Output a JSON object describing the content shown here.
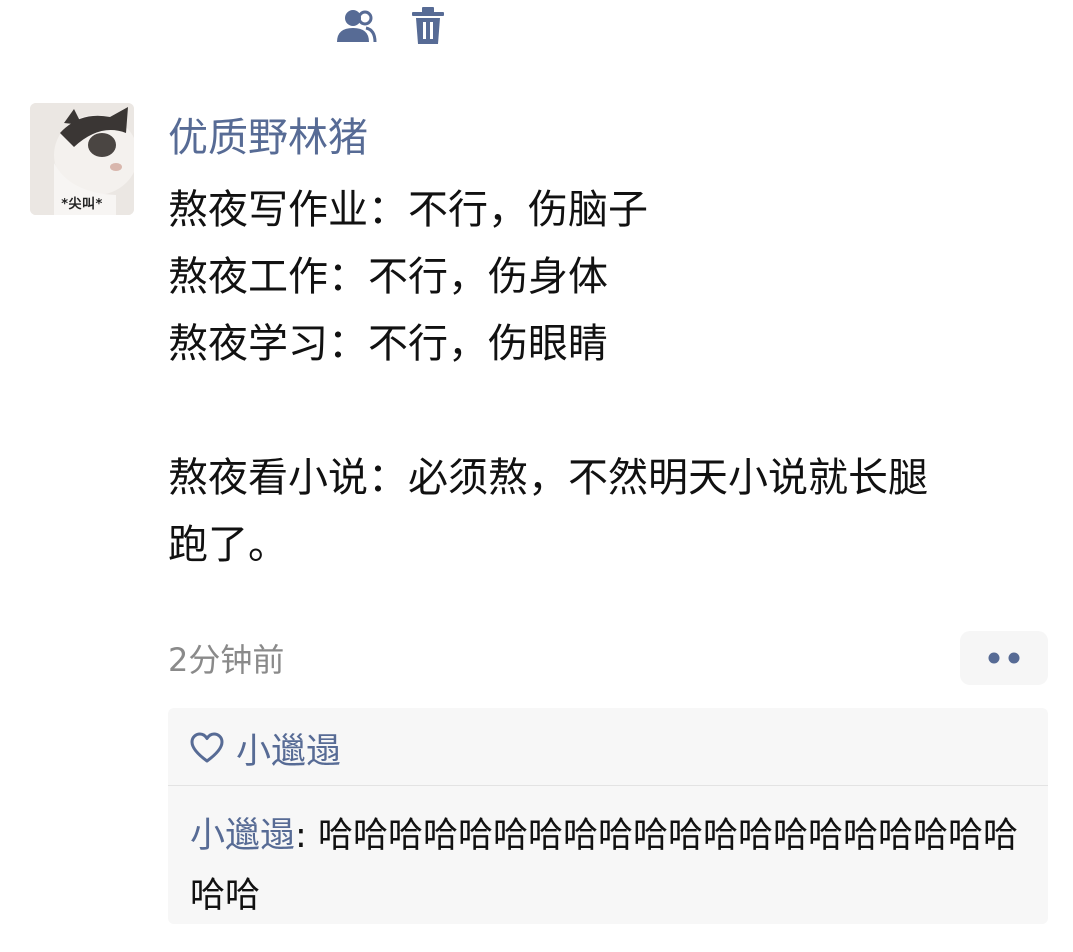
{
  "post": {
    "avatar_caption": "*尖叫*",
    "username": "优质野林猪",
    "content_lines": [
      "熬夜写作业：不行，伤脑子",
      "熬夜工作：不行，伤身体",
      "熬夜学习：不行，伤眼睛",
      "",
      "熬夜看小说：必须熬，不然明天小说就长腿",
      "跑了。"
    ],
    "time": "2分钟前"
  },
  "icons": {
    "privacy": "friends-visibility-icon",
    "delete": "trash-icon",
    "more": "more-dots-icon",
    "like": "heart-icon"
  },
  "colors": {
    "link": "#576b95",
    "comment_bg": "#f7f7f7",
    "meta_text": "#8a8a8a"
  },
  "interactions": {
    "likes": [
      "小邋遢"
    ],
    "comments": [
      {
        "author": "小邋遢",
        "separator": ": ",
        "text": "哈哈哈哈哈哈哈哈哈哈哈哈哈哈哈哈哈哈哈哈哈哈"
      }
    ]
  }
}
